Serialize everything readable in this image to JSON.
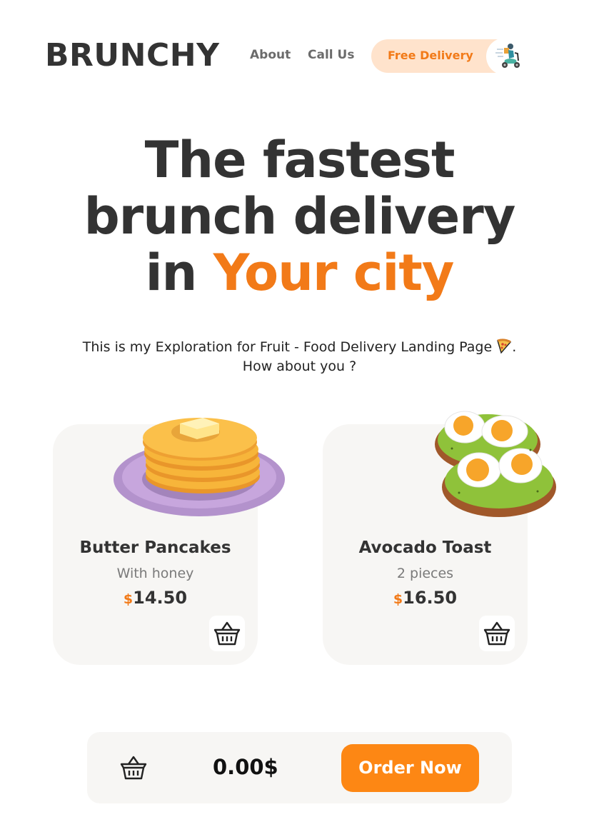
{
  "brand": {
    "logo": "BRUNCHY"
  },
  "nav": {
    "about": "About",
    "call_us": "Call Us",
    "delivery": "Free Delivery",
    "delivery_icon": "scooter-rider-icon"
  },
  "hero": {
    "line1": "The fastest",
    "line2": "brunch delivery",
    "line3_prefix": "in ",
    "line3_accent": "Your city",
    "subtitle_line1": "This is my Exploration for Fruit - Food Delivery Landing Page",
    "subtitle_period": ".",
    "subtitle_line2": "How about you ?",
    "subtitle_icon": "pizza-icon"
  },
  "products": [
    {
      "name": "Butter Pancakes",
      "detail": "With honey",
      "currency": "$",
      "price": "14.50",
      "image": "pancakes-illustration",
      "cart_icon": "basket-icon"
    },
    {
      "name": "Avocado Toast",
      "detail": "2 pieces",
      "currency": "$",
      "price": "16.50",
      "image": "avocado-toast-illustration",
      "cart_icon": "basket-icon"
    }
  ],
  "order_bar": {
    "total": "0.00$",
    "button": "Order Now",
    "cart_icon": "basket-icon"
  },
  "colors": {
    "accent": "#f27a18",
    "button": "#fd8714",
    "pill": "#ffe3cc",
    "card": "#f7f6f4",
    "text": "#333333"
  }
}
